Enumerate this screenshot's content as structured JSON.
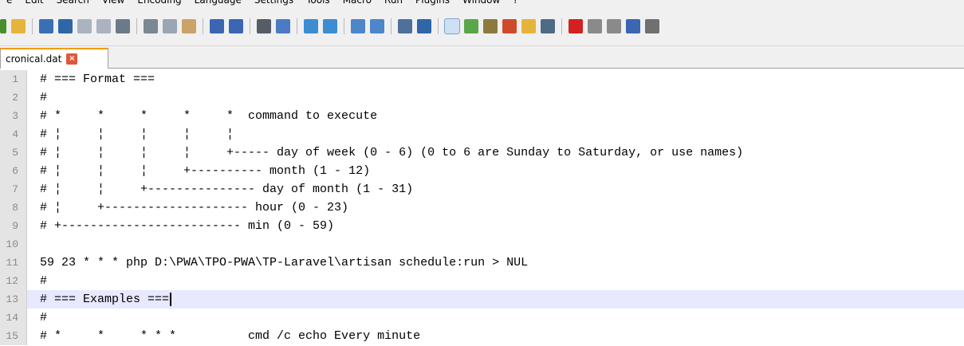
{
  "menu": [
    "e",
    "Edit",
    "Search",
    "View",
    "Encoding",
    "Language",
    "Settings",
    "Tools",
    "Macro",
    "Run",
    "Plugins",
    "Window",
    "?"
  ],
  "toolbar_icons": [
    {
      "name": "new-file-icon",
      "color": "#4a8f2c"
    },
    {
      "name": "open-file-icon",
      "color": "#e7b43b"
    },
    {
      "name": "save-icon",
      "color": "#3a6fb6"
    },
    {
      "name": "save-all-icon",
      "color": "#2f66a8"
    },
    {
      "name": "close-icon",
      "color": "#aab3bf"
    },
    {
      "name": "close-all-icon",
      "color": "#aab3bf"
    },
    {
      "name": "print-icon",
      "color": "#6b7a89"
    },
    {
      "name": "cut-icon",
      "color": "#7b8793"
    },
    {
      "name": "copy-icon",
      "color": "#9aa6b3"
    },
    {
      "name": "paste-icon",
      "color": "#caa26a"
    },
    {
      "name": "undo-icon",
      "color": "#3a66b2"
    },
    {
      "name": "redo-icon",
      "color": "#3a66b2"
    },
    {
      "name": "find-icon",
      "color": "#555d66"
    },
    {
      "name": "replace-icon",
      "color": "#4b7bc4"
    },
    {
      "name": "zoom-in-icon",
      "color": "#3c8ed0"
    },
    {
      "name": "zoom-out-icon",
      "color": "#3c8ed0"
    },
    {
      "name": "sync-vertical-icon",
      "color": "#4d86c9"
    },
    {
      "name": "sync-horizontal-icon",
      "color": "#4d86c9"
    },
    {
      "name": "word-wrap-icon",
      "color": "#4f6f9c"
    },
    {
      "name": "show-all-chars-icon",
      "color": "#2f66a8"
    },
    {
      "name": "indent-guide-icon",
      "color": "#3a6fb6"
    },
    {
      "name": "doc-map-icon",
      "color": "#5aa64a"
    },
    {
      "name": "function-list-icon",
      "color": "#8b7a3c"
    },
    {
      "name": "folder-workspace-icon",
      "color": "#d04a2a"
    },
    {
      "name": "folder-icon",
      "color": "#e7b43b"
    },
    {
      "name": "monitoring-icon",
      "color": "#4e6b84"
    },
    {
      "name": "record-macro-icon",
      "color": "#d32020"
    },
    {
      "name": "stop-record-icon",
      "color": "#8a8a8a"
    },
    {
      "name": "play-macro-icon",
      "color": "#8a8a8a"
    },
    {
      "name": "run-macro-multiple-icon",
      "color": "#3a66b2"
    },
    {
      "name": "save-macro-icon",
      "color": "#707070"
    }
  ],
  "tab": {
    "filename": "cronical.dat",
    "close_glyph": "×"
  },
  "lines": [
    {
      "num": "1",
      "text": "# === Format ==="
    },
    {
      "num": "2",
      "text": "#"
    },
    {
      "num": "3",
      "text": "# *     *     *     *     *  command to execute"
    },
    {
      "num": "4",
      "text": "# ¦     ¦     ¦     ¦     ¦"
    },
    {
      "num": "5",
      "text": "# ¦     ¦     ¦     ¦     +----- day of week (0 - 6) (0 to 6 are Sunday to Saturday, or use names)"
    },
    {
      "num": "6",
      "text": "# ¦     ¦     ¦     +---------- month (1 - 12)"
    },
    {
      "num": "7",
      "text": "# ¦     ¦     +--------------- day of month (1 - 31)"
    },
    {
      "num": "8",
      "text": "# ¦     +-------------------- hour (0 - 23)"
    },
    {
      "num": "9",
      "text": "# +------------------------- min (0 - 59)"
    },
    {
      "num": "10",
      "text": ""
    },
    {
      "num": "11",
      "text": "59 23 * * * php D:\\PWA\\TPO-PWA\\TP-Laravel\\artisan schedule:run > NUL"
    },
    {
      "num": "12",
      "text": "#"
    },
    {
      "num": "13",
      "text": "# === Examples ===",
      "current": true
    },
    {
      "num": "14",
      "text": "#"
    },
    {
      "num": "15",
      "text": "# *     *     * * *          cmd /c echo Every minute"
    }
  ]
}
